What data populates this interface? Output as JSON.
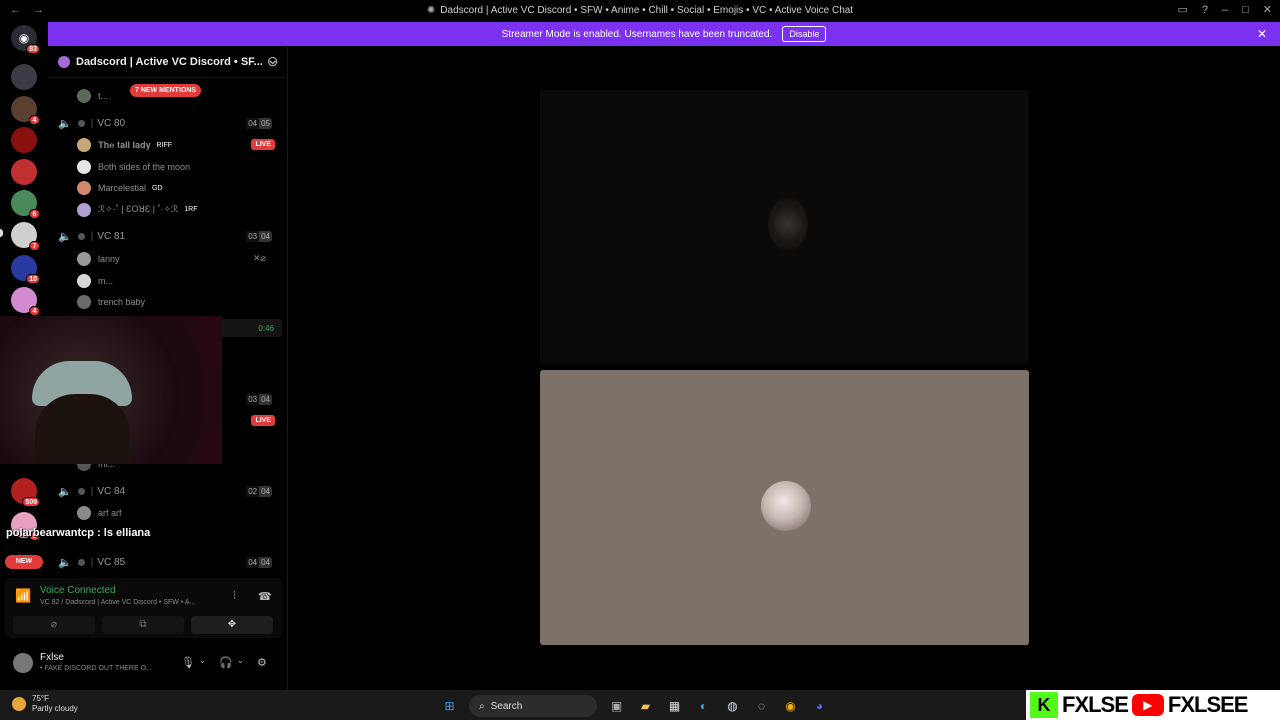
{
  "window": {
    "title": "Dadscord | Active VC Discord • SFW • Anime • Chill • Social • Emojis • VC • Active Voice Chat"
  },
  "banner": {
    "text": "Streamer Mode is enabled. Usernames have been truncated.",
    "disable_label": "Disable"
  },
  "rail": {
    "home_badge": "83",
    "servers": [
      {
        "badge": "",
        "color": "#3c3c46"
      },
      {
        "badge": "4",
        "color": "#5a4030"
      },
      {
        "badge": "",
        "color": "#8a1010"
      },
      {
        "badge": "",
        "color": "#c03030"
      },
      {
        "badge": "6",
        "color": "#4a8a5a"
      },
      {
        "badge": "7",
        "color": "#cfcfcf"
      },
      {
        "badge": "10",
        "color": "#2a3aa0"
      },
      {
        "badge": "4",
        "color": "#d28ad0"
      },
      {
        "badge": "509",
        "color": "#b02020"
      },
      {
        "badge": "5",
        "color": "#e6a0c0"
      }
    ],
    "new_label": "NEW"
  },
  "sidebar": {
    "server_name": "Dadscord | Active VC Discord • SF...",
    "mentions": "7 NEW MENTIONS",
    "truncated_user": "t...",
    "channels": [
      {
        "name": "VC 80",
        "count": "04",
        "limit": "05"
      },
      {
        "name": "VC 81",
        "count": "03",
        "limit": "04"
      },
      {
        "name": "VC 84",
        "count": "02",
        "limit": "04"
      },
      {
        "name": "VC 85",
        "count": "04",
        "limit": "04"
      }
    ],
    "hidden_channel": {
      "count": "03",
      "limit": "04"
    },
    "vc80_users": [
      {
        "name": "𝐓𝐡𝐞 𝐭𝐚𝐥𝐥 𝐥𝐚𝐝𝐲",
        "tag": "RIFF",
        "color": "#c7a87a"
      },
      {
        "name": "Both sides of the moon",
        "tag": "",
        "color": "#e5e5e5"
      },
      {
        "name": "Marcelestial",
        "tag": "GD",
        "color": "#d08a6a"
      },
      {
        "name": "ℛ✧·˚ | ƐOꓤƐ | ˚·✧ℛ",
        "tag": "1RF",
        "color": "#b0a0d0"
      }
    ],
    "vc81_users": [
      {
        "name": "lanny",
        "color": "#9a9a9a"
      },
      {
        "name": "m...",
        "color": "#d6d6d6"
      },
      {
        "name": "trench baby",
        "color": "#6a6a6a"
      }
    ],
    "vc84_users": [
      {
        "name": "arf arf",
        "color": "#8a8a8a"
      }
    ],
    "partial_user": "mi...",
    "live_label": "LIVE",
    "timer": "0:46"
  },
  "voice": {
    "status": "Voice Connected",
    "channel": "VC 82 / Dadscord | Active VC Discord • SFW • A..."
  },
  "user": {
    "name": "Fxlse",
    "status": "• FAKE DISCORD OUT THERE O..."
  },
  "webcam": {
    "caption": "polarbearwantcp : ls elliana"
  },
  "taskbar": {
    "temp": "75°F",
    "weather": "Partly cloudy",
    "search": "Search"
  },
  "branding": {
    "name1": "FXLSE",
    "name2": "FXLSEE"
  }
}
